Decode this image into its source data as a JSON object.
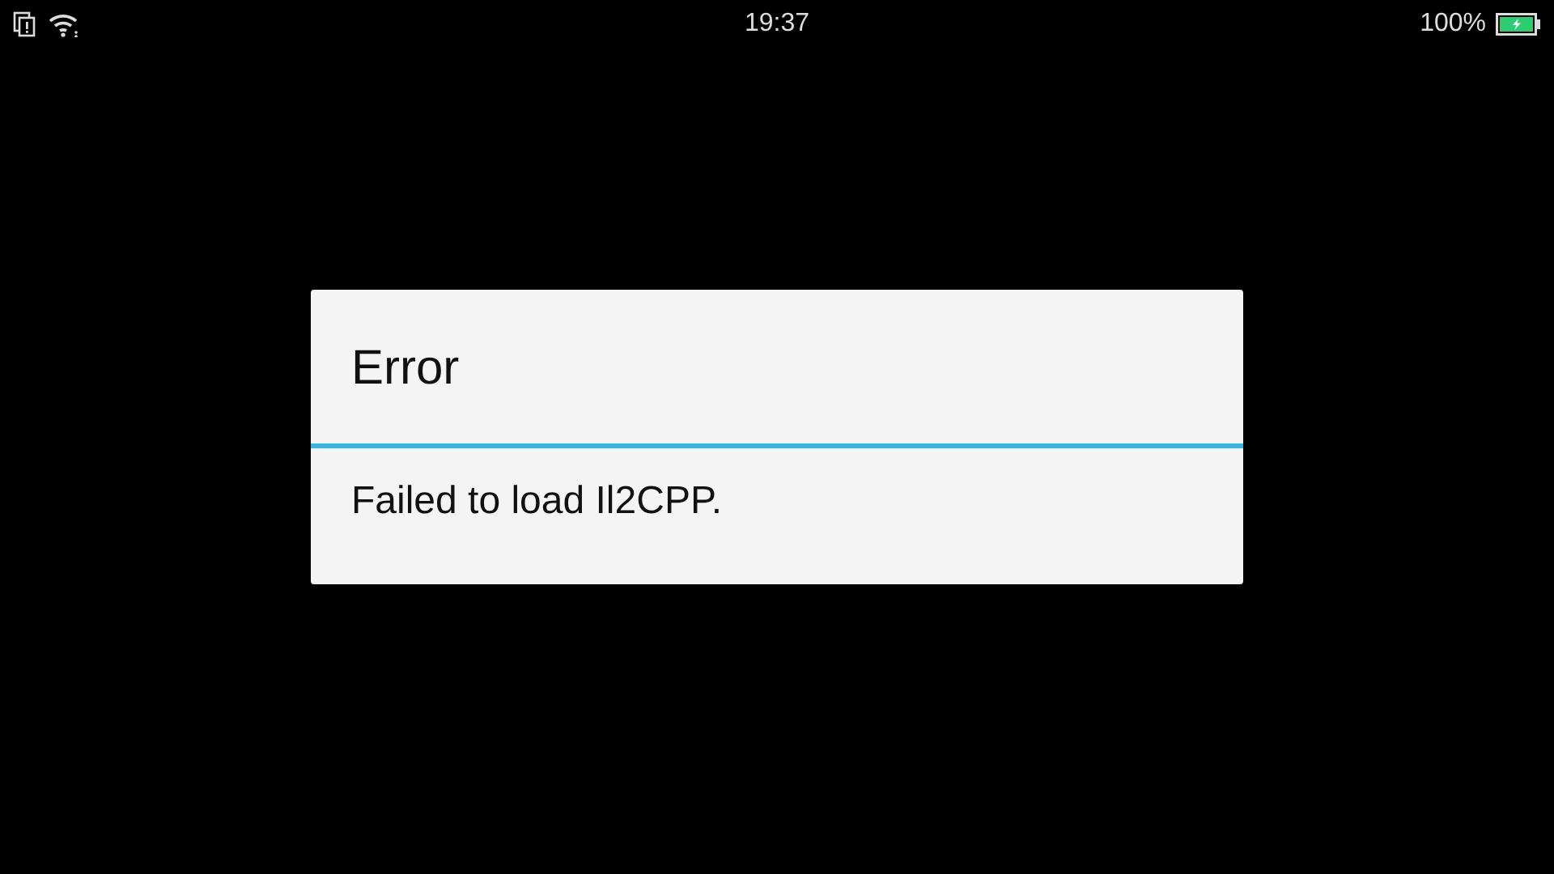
{
  "status_bar": {
    "time": "19:37",
    "battery_text": "100%"
  },
  "dialog": {
    "title": "Error",
    "message": "Failed to load Il2CPP."
  }
}
